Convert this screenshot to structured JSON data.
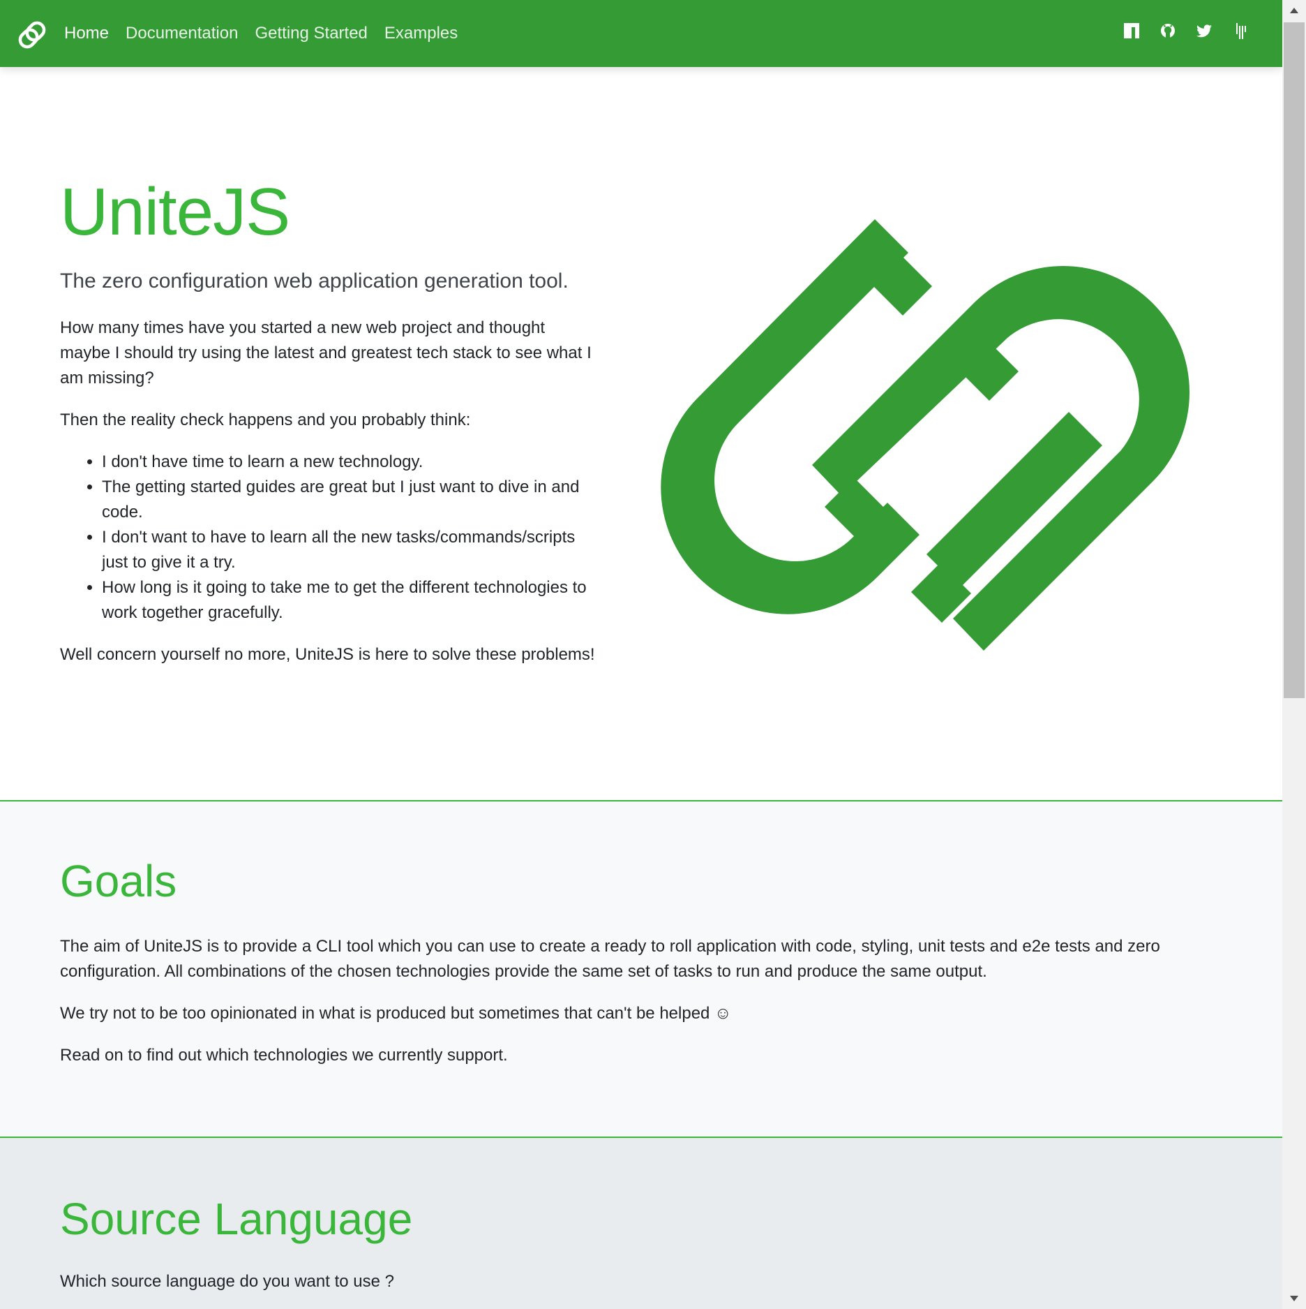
{
  "navbar": {
    "brand_icon": "unitejs-logo-icon",
    "links": [
      {
        "label": "Home",
        "active": true
      },
      {
        "label": "Documentation",
        "active": false
      },
      {
        "label": "Getting Started",
        "active": false
      },
      {
        "label": "Examples",
        "active": false
      }
    ],
    "icons": [
      "npm-icon",
      "github-icon",
      "twitter-icon",
      "gitter-icon"
    ]
  },
  "hero": {
    "title": "UniteJS",
    "subtitle": "The zero configuration web application generation tool.",
    "paragraph1": "How many times have you started a new web project and thought maybe I should try using the latest and greatest tech stack to see what I am missing?",
    "paragraph2": "Then the reality check happens and you probably think:",
    "bullets": [
      "I don't have time to learn a new technology.",
      "The getting started guides are great but I just want to dive in and code.",
      "I don't want to have to learn all the new tasks/commands/scripts just to give it a try.",
      "How long is it going to take me to get the different technologies to work together gracefully."
    ],
    "paragraph3": "Well concern yourself no more, UniteJS is here to solve these problems!",
    "logo_icon": "unitejs-logo-icon"
  },
  "goals": {
    "title": "Goals",
    "paragraph1": "The aim of UniteJS is to provide a CLI tool which you can use to create a ready to roll application with code, styling, unit tests and e2e tests and zero configuration. All combinations of the chosen technologies provide the same set of tasks to run and produce the same output.",
    "paragraph2": "We try not to be too opinionated in what is produced but sometimes that can't be helped ☺",
    "paragraph3": "Read on to find out which technologies we currently support."
  },
  "source_language": {
    "title": "Source Language",
    "question": "Which source language do you want to use ?"
  },
  "colors": {
    "navbar_bg": "#349b35",
    "heading_green": "#3ab63b",
    "logo_green": "#349b35",
    "goals_bg": "#f8f9fa",
    "source_bg": "#e9ecef"
  }
}
